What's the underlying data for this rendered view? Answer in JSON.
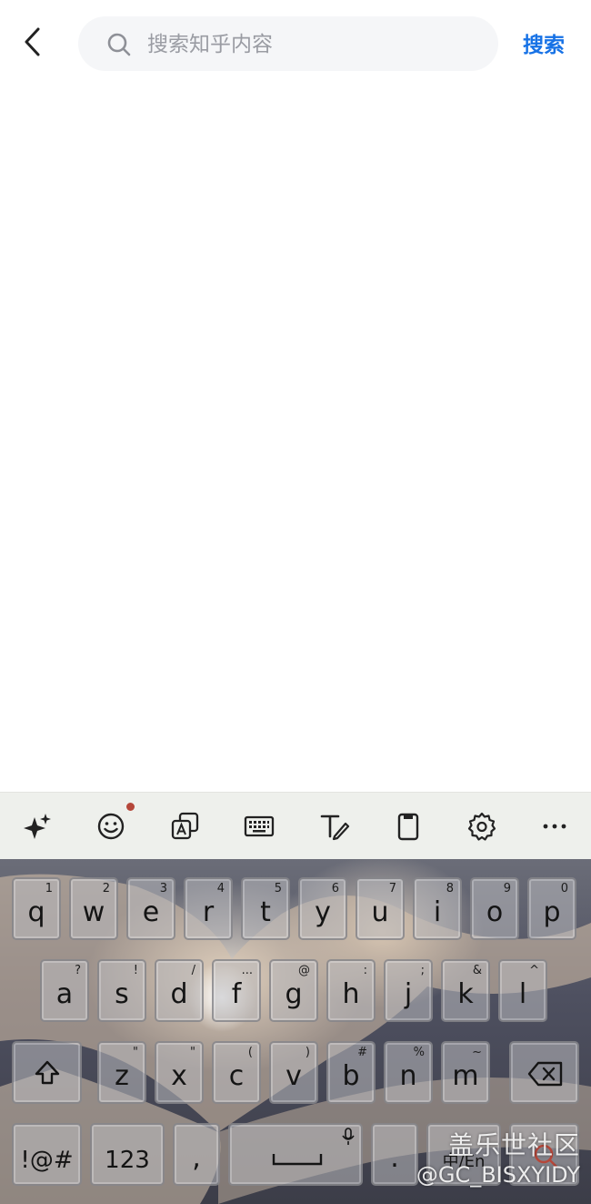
{
  "header": {
    "search_placeholder": "搜索知乎内容",
    "search_button": "搜索"
  },
  "toolbar": {
    "items": [
      "ai-sparkle",
      "emoji",
      "translate",
      "keyboard-layout",
      "handwriting",
      "clipboard",
      "settings",
      "more"
    ],
    "notification_dot_color": "#b5473a"
  },
  "keyboard": {
    "row1": [
      {
        "key": "q",
        "sub": "1"
      },
      {
        "key": "w",
        "sub": "2"
      },
      {
        "key": "e",
        "sub": "3"
      },
      {
        "key": "r",
        "sub": "4"
      },
      {
        "key": "t",
        "sub": "5"
      },
      {
        "key": "y",
        "sub": "6"
      },
      {
        "key": "u",
        "sub": "7"
      },
      {
        "key": "i",
        "sub": "8"
      },
      {
        "key": "o",
        "sub": "9"
      },
      {
        "key": "p",
        "sub": "0"
      }
    ],
    "row2": [
      {
        "key": "a",
        "sub": "?"
      },
      {
        "key": "s",
        "sub": "!"
      },
      {
        "key": "d",
        "sub": "/"
      },
      {
        "key": "f",
        "sub": "..."
      },
      {
        "key": "g",
        "sub": "@"
      },
      {
        "key": "h",
        "sub": ":"
      },
      {
        "key": "j",
        "sub": ";"
      },
      {
        "key": "k",
        "sub": "&"
      },
      {
        "key": "l",
        "sub": "^"
      }
    ],
    "row3": [
      {
        "key": "z",
        "sub": "\""
      },
      {
        "key": "x",
        "sub": "\""
      },
      {
        "key": "c",
        "sub": "("
      },
      {
        "key": "v",
        "sub": ")"
      },
      {
        "key": "b",
        "sub": "#"
      },
      {
        "key": "n",
        "sub": "%"
      },
      {
        "key": "m",
        "sub": "~"
      }
    ],
    "symbols_key": "!@#",
    "numbers_key": "123",
    "comma_key": ",",
    "period_key": ".",
    "lang_key": "中/En"
  },
  "watermark": {
    "line1": "盖乐世社区",
    "line2": "@GC_BISXYIDY"
  }
}
